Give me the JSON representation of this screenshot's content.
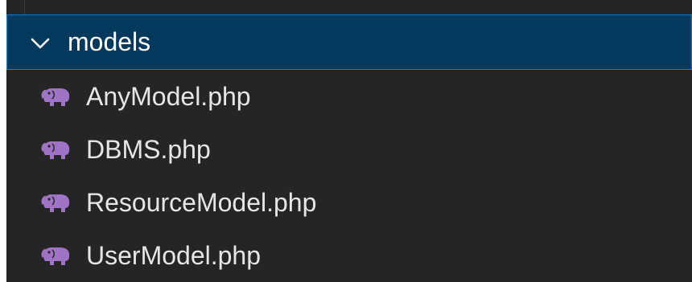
{
  "explorer": {
    "folder": {
      "name": "models",
      "expanded": true,
      "chevron_icon": "chevron-down-icon"
    },
    "files": [
      {
        "name": "AnyModel.php",
        "icon": "php-elephant-icon"
      },
      {
        "name": "DBMS.php",
        "icon": "php-elephant-icon"
      },
      {
        "name": "ResourceModel.php",
        "icon": "php-elephant-icon"
      },
      {
        "name": "UserModel.php",
        "icon": "php-elephant-icon"
      }
    ]
  },
  "colors": {
    "panel_background": "#252526",
    "selected_row_background": "#04395e",
    "selected_row_border": "#007fd4",
    "php_icon": "#a074c4",
    "text": "#e6e6e6"
  }
}
